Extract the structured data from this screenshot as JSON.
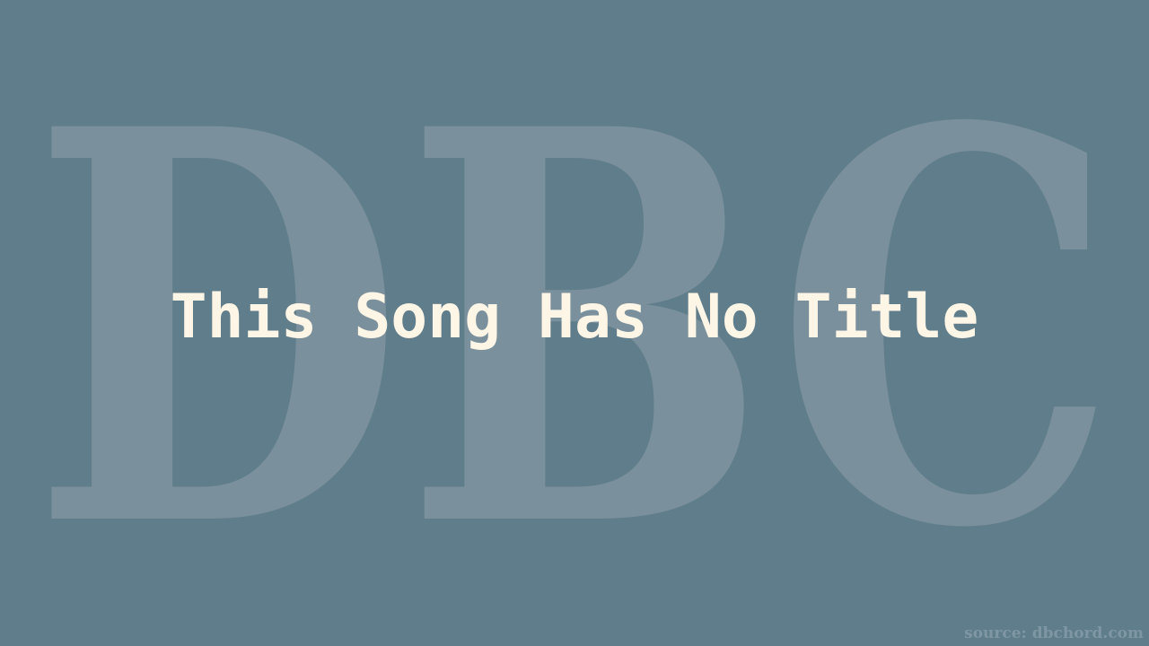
{
  "watermark": {
    "text": "DBC"
  },
  "title": "This Song Has No Title",
  "source": "source: dbchord.com",
  "colors": {
    "background": "#607d8b",
    "watermark": "#7a909c",
    "title": "#fdf5e6",
    "source": "#7f97a4"
  }
}
